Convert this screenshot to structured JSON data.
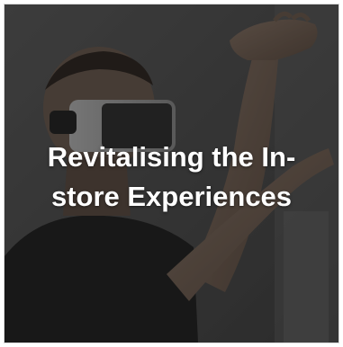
{
  "tile": {
    "title_line_1": "Revitalising the In-",
    "title_line_2": "store Experiences",
    "overlay_color": "#121212",
    "text_color": "#ffffff",
    "photo_subject": "man-wearing-vr-headset"
  }
}
